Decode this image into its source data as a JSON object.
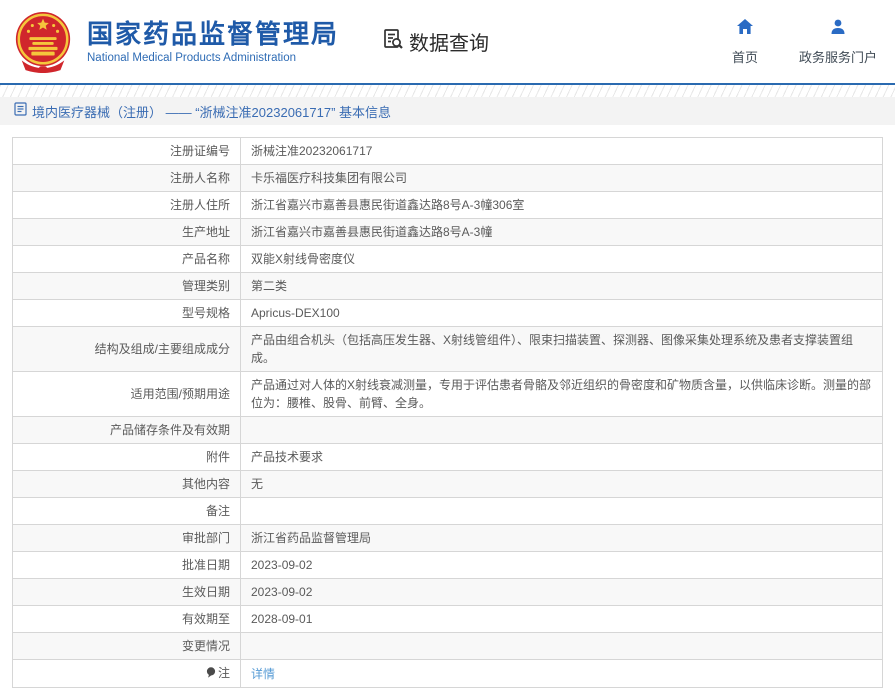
{
  "header": {
    "org_title": "国家药品监督管理局",
    "org_subtitle": "National Medical Products Administration",
    "section_label": "数据查询",
    "nav": {
      "home": "首页",
      "portal": "政务服务门户"
    }
  },
  "breadcrumb": {
    "label": "境内医疗器械（注册） —— “浙械注准20232061717” 基本信息"
  },
  "table": {
    "rows": [
      {
        "label": "注册证编号",
        "value": "浙械注准20232061717"
      },
      {
        "label": "注册人名称",
        "value": "卡乐福医疗科技集团有限公司"
      },
      {
        "label": "注册人住所",
        "value": "浙江省嘉兴市嘉善县惠民街道鑫达路8号A-3幢306室"
      },
      {
        "label": "生产地址",
        "value": "浙江省嘉兴市嘉善县惠民街道鑫达路8号A-3幢"
      },
      {
        "label": "产品名称",
        "value": "双能X射线骨密度仪"
      },
      {
        "label": "管理类别",
        "value": "第二类"
      },
      {
        "label": "型号规格",
        "value": "Apricus-DEX100"
      },
      {
        "label": "结构及组成/主要组成成分",
        "value": "产品由组合机头（包括高压发生器、X射线管组件）、限束扫描装置、探测器、图像采集处理系统及患者支撑装置组成。"
      },
      {
        "label": "适用范围/预期用途",
        "value": "产品通过对人体的X射线衰减测量，专用于评估患者骨骼及邻近组织的骨密度和矿物质含量，以供临床诊断。测量的部位为：腰椎、股骨、前臂、全身。"
      },
      {
        "label": "产品储存条件及有效期",
        "value": ""
      },
      {
        "label": "附件",
        "value": "产品技术要求"
      },
      {
        "label": "其他内容",
        "value": "无"
      },
      {
        "label": "备注",
        "value": ""
      },
      {
        "label": "审批部门",
        "value": "浙江省药品监督管理局"
      },
      {
        "label": "批准日期",
        "value": "2023-09-02"
      },
      {
        "label": "生效日期",
        "value": "2023-09-02"
      },
      {
        "label": "有效期至",
        "value": "2028-09-01"
      },
      {
        "label": "变更情况",
        "value": ""
      },
      {
        "label": "注",
        "value": "详情"
      }
    ]
  },
  "colors": {
    "brand_blue": "#1f5aa8",
    "icon_blue": "#2a6bc4",
    "link_blue": "#569bd5",
    "emblem_red": "#d0262c",
    "emblem_gold": "#f5c63c",
    "border_gray": "#d6d6d6"
  }
}
